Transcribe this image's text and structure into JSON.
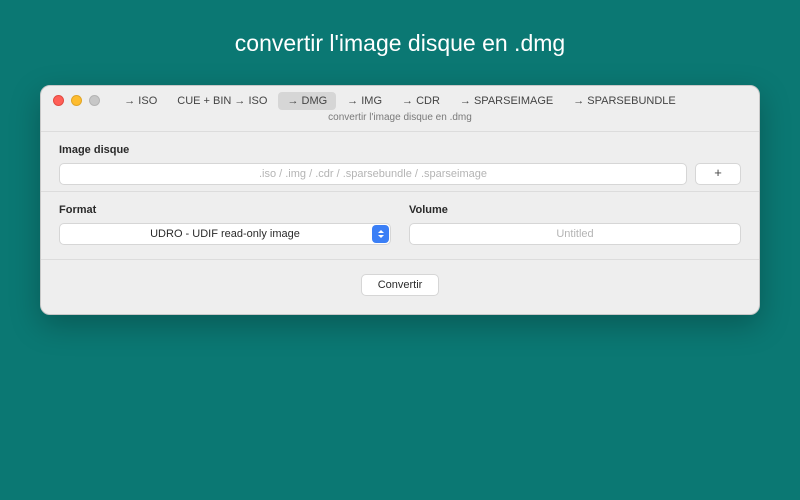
{
  "page": {
    "title": "convertir l'image disque en .dmg"
  },
  "tabs": {
    "items": [
      {
        "label": "→ ISO"
      },
      {
        "label": "CUE + BIN → ISO"
      },
      {
        "label": "→ DMG"
      },
      {
        "label": "→ IMG"
      },
      {
        "label": "→ CDR"
      },
      {
        "label": "→ SPARSEIMAGE"
      },
      {
        "label": "→ SPARSEBUNDLE"
      }
    ],
    "subtitle": "convertir l'image disque en .dmg"
  },
  "disk_image": {
    "label": "Image disque",
    "placeholder": ".iso / .img / .cdr / .sparsebundle / .sparseimage",
    "add_button": "+"
  },
  "format": {
    "label": "Format",
    "selected": "UDRO - UDIF read-only image"
  },
  "volume": {
    "label": "Volume",
    "placeholder": "Untitled"
  },
  "footer": {
    "convert": "Convertir"
  }
}
